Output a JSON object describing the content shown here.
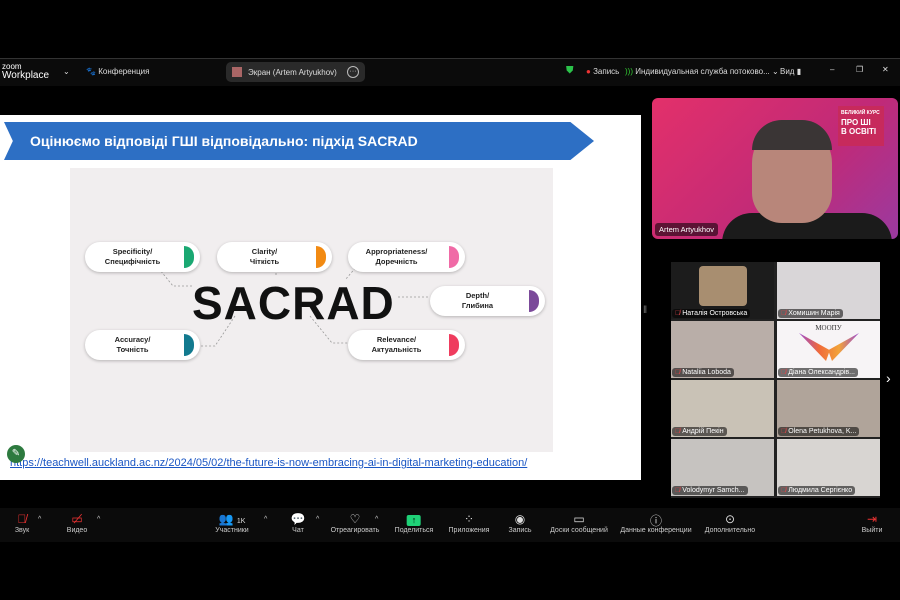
{
  "topbar": {
    "logo_small": "zoom",
    "logo_big": "Workplace",
    "meeting_label": "Конференция",
    "share_label": "Экран (Artem Artyukhov)",
    "record_label": "Запись",
    "stream_label": "Индивидуальная служба потоково...",
    "view_label": "Вид"
  },
  "slide": {
    "title": "Оцінюємо відповіді ГШІ відповідально: підхід SACRAD",
    "center": "SACRAD",
    "link": "https://teachwell.auckland.ac.nz/2024/05/02/the-future-is-now-embracing-ai-in-digital-marketing-education/",
    "items": [
      {
        "en": "Specificity/",
        "uk": "Специфічність",
        "color": "#1aa872"
      },
      {
        "en": "Clarity/",
        "uk": "Чіткість",
        "color": "#f28a12"
      },
      {
        "en": "Appropriateness/",
        "uk": "Доречність",
        "color": "#f06aa6"
      },
      {
        "en": "Depth/",
        "uk": "Глибина",
        "color": "#7b4a9a"
      },
      {
        "en": "Accuracy/",
        "uk": "Точність",
        "color": "#127a8f"
      },
      {
        "en": "Relevance/",
        "uk": "Актуальність",
        "color": "#ef3c5e"
      }
    ]
  },
  "speaker": {
    "name": "Artem Artyukhov",
    "badge": [
      "ВЕЛИКИЙ КУРС",
      "ПРО ШІ",
      "В ОСВІТІ"
    ]
  },
  "participants": [
    {
      "name": "Наталія Островська",
      "bg": "#a88e70"
    },
    {
      "name": "Хомишин Марія",
      "bg": "#d9d6d8"
    },
    {
      "name": "Nataliia Loboda",
      "bg": "#b9aea8"
    },
    {
      "name": "Діана Олександрів...",
      "bg": "#f7f4f6"
    },
    {
      "name": "Андрій Пекін",
      "bg": "#c9c2b6"
    },
    {
      "name": "Olena Petukhova, K...",
      "bg": "#b0a49a"
    },
    {
      "name": "Volodymyr Samch...",
      "bg": "#c6c3c0"
    },
    {
      "name": "Людмила Сергієнко",
      "bg": "#d8d5d2"
    }
  ],
  "gallery_logo": "МООПУ",
  "participants_count": "1K",
  "toolbar": {
    "audio": "Звук",
    "video": "Видео",
    "participants": "Участники",
    "chat": "Чат",
    "react": "Отреагировать",
    "share": "Поделиться",
    "apps": "Приложения",
    "record": "Запись",
    "whiteboards": "Доски сообщений",
    "info": "Данные конференции",
    "more": "Дополнительно",
    "leave": "Выйти"
  }
}
